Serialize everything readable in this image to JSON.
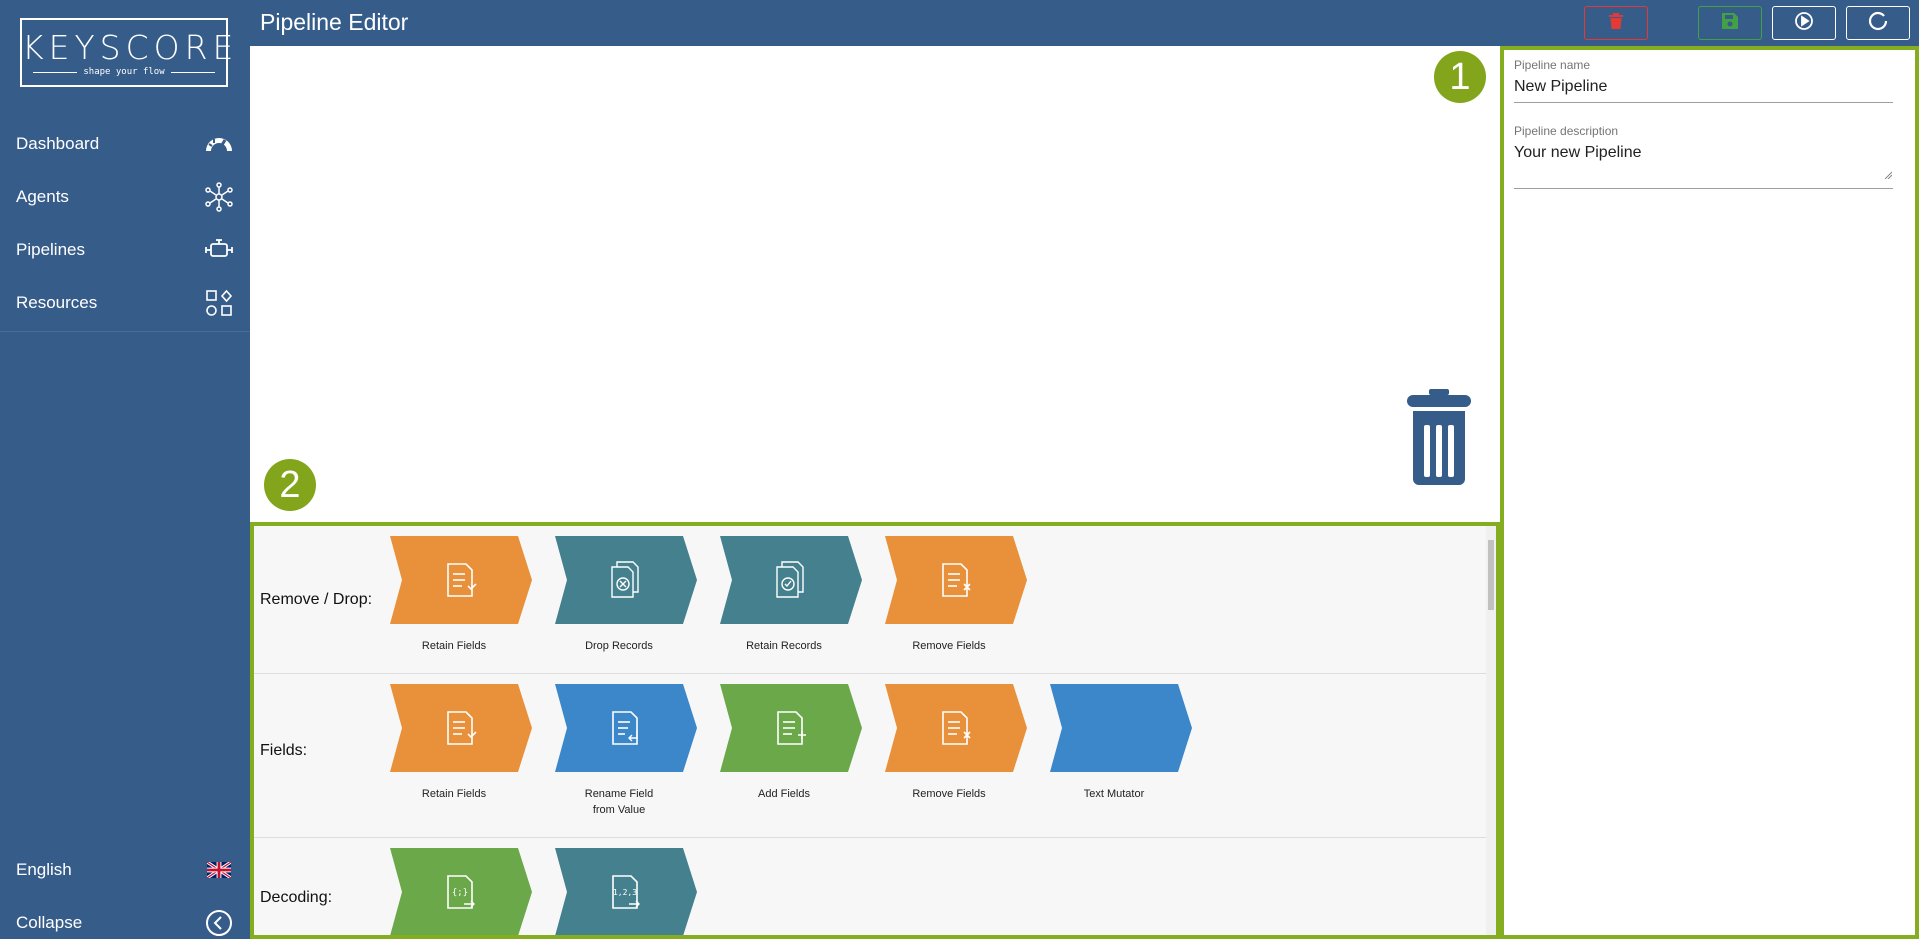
{
  "logo": {
    "word": "KEYSCORE",
    "tagline": "shape your flow"
  },
  "nav": [
    {
      "label": "Dashboard",
      "icon": "dashboard-icon"
    },
    {
      "label": "Agents",
      "icon": "agents-icon"
    },
    {
      "label": "Pipelines",
      "icon": "pipelines-icon"
    },
    {
      "label": "Resources",
      "icon": "resources-icon"
    }
  ],
  "footer": {
    "language": "English",
    "language_icon": "uk-flag-icon",
    "collapse": "Collapse"
  },
  "header": {
    "title": "Pipeline Editor"
  },
  "badges": {
    "one": "1",
    "two": "2"
  },
  "form": {
    "name_label": "Pipeline name",
    "name_value": "New Pipeline",
    "description_label": "Pipeline description",
    "description_value": "Your new Pipeline"
  },
  "categories": [
    {
      "label": "Remove / Drop:",
      "blocks": [
        {
          "label": "Retain Fields",
          "color": "#e8903a",
          "icon": "retain-fields-icon"
        },
        {
          "label": "Drop Records",
          "color": "#44808e",
          "icon": "drop-records-icon"
        },
        {
          "label": "Retain Records",
          "color": "#44808e",
          "icon": "retain-records-icon"
        },
        {
          "label": "Remove Fields",
          "color": "#e8903a",
          "icon": "remove-fields-icon"
        }
      ]
    },
    {
      "label": "Fields:",
      "blocks": [
        {
          "label": "Retain Fields",
          "color": "#e8903a",
          "icon": "retain-fields-icon"
        },
        {
          "label": "Rename Field from Value",
          "color": "#3b87c9",
          "icon": "rename-field-icon"
        },
        {
          "label": "Add Fields",
          "color": "#6aa84a",
          "icon": "add-fields-icon"
        },
        {
          "label": "Remove Fields",
          "color": "#e8903a",
          "icon": "remove-fields-icon"
        },
        {
          "label": "Text Mutator",
          "color": "#3b87c9",
          "icon": ""
        }
      ]
    },
    {
      "label": "Decoding:",
      "blocks": [
        {
          "label": "",
          "color": "#6aa84a",
          "icon": "json-decode-icon"
        },
        {
          "label": "",
          "color": "#44808e",
          "icon": "csv-decode-icon"
        }
      ]
    }
  ],
  "colors": {
    "sidebar": "#365c8a",
    "accent": "#85ad20",
    "delete": "#e53935",
    "save": "#43a047"
  }
}
